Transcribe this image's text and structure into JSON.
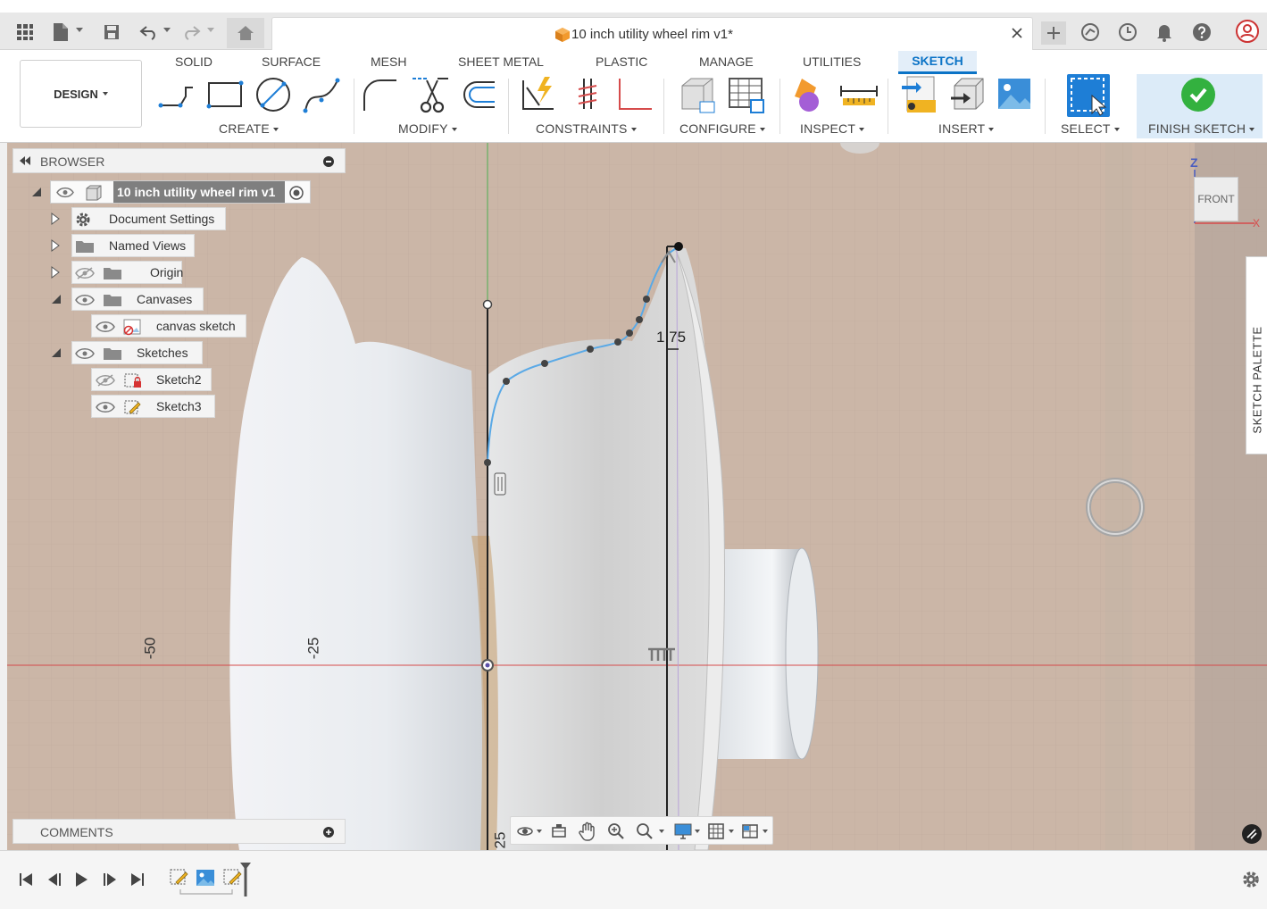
{
  "window": {
    "document_title": "10 inch utility wheel rim v1*"
  },
  "ribbon": {
    "workspace_label": "DESIGN",
    "tabs": [
      {
        "label": "SOLID"
      },
      {
        "label": "SURFACE"
      },
      {
        "label": "MESH"
      },
      {
        "label": "SHEET METAL"
      },
      {
        "label": "PLASTIC"
      },
      {
        "label": "MANAGE"
      },
      {
        "label": "UTILITIES"
      },
      {
        "label": "SKETCH"
      }
    ],
    "active_tab": "SKETCH",
    "groups": {
      "create": "CREATE",
      "modify": "MODIFY",
      "constraints": "CONSTRAINTS",
      "configure": "CONFIGURE",
      "inspect": "INSPECT",
      "insert": "INSERT",
      "select": "SELECT",
      "finish": "FINISH SKETCH"
    }
  },
  "browser": {
    "title": "BROWSER",
    "root": "10 inch utility wheel rim v1",
    "nodes": [
      {
        "label": "Document Settings"
      },
      {
        "label": "Named Views"
      },
      {
        "label": "Origin"
      },
      {
        "label": "Canvases"
      },
      {
        "label": "canvas sketch"
      },
      {
        "label": "Sketches"
      },
      {
        "label": "Sketch2"
      },
      {
        "label": "Sketch3"
      }
    ]
  },
  "comments": {
    "title": "COMMENTS"
  },
  "viewport": {
    "dimension": "1.75",
    "axis_labels": [
      "-50",
      "-25",
      "25"
    ],
    "viewcube": {
      "face": "FRONT",
      "axis_z": "Z",
      "axis_x": "X"
    }
  },
  "sketch_palette": {
    "label": "SKETCH PALETTE"
  },
  "colors": {
    "accent": "#0b73c6",
    "finish_green": "#33b13f",
    "sketch_curve": "#5aa9e6",
    "axis_red": "#d64b4b",
    "axis_green": "#4caf50"
  }
}
